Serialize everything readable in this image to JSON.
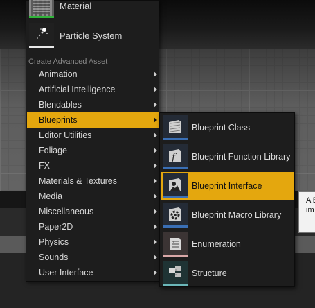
{
  "top_assets": [
    {
      "label": "Material",
      "icon": "material-icon"
    },
    {
      "label": "Particle System",
      "icon": "particle-system-icon"
    }
  ],
  "section_header": "Create Advanced Asset",
  "menu_items": [
    {
      "label": "Animation"
    },
    {
      "label": "Artificial Intelligence"
    },
    {
      "label": "Blendables"
    },
    {
      "label": "Blueprints",
      "active": true
    },
    {
      "label": "Editor Utilities"
    },
    {
      "label": "Foliage"
    },
    {
      "label": "FX"
    },
    {
      "label": "Materials & Textures"
    },
    {
      "label": "Media"
    },
    {
      "label": "Miscellaneous"
    },
    {
      "label": "Paper2D"
    },
    {
      "label": "Physics"
    },
    {
      "label": "Sounds"
    },
    {
      "label": "User Interface"
    }
  ],
  "submenu_items": [
    {
      "label": "Blueprint Class",
      "icon": "blueprint-class-icon"
    },
    {
      "label": "Blueprint Function Library",
      "icon": "blueprint-function-library-icon"
    },
    {
      "label": "Blueprint Interface",
      "icon": "blueprint-interface-icon",
      "active": true
    },
    {
      "label": "Blueprint Macro Library",
      "icon": "blueprint-macro-library-icon"
    },
    {
      "label": "Enumeration",
      "icon": "enumeration-icon"
    },
    {
      "label": "Structure",
      "icon": "structure-icon"
    }
  ],
  "tooltip": {
    "line1": "A B",
    "line2": "im"
  },
  "colors": {
    "highlight": "#e4a70e",
    "menu_bg": "#1d1d1d",
    "text": "#dcdcdc"
  }
}
